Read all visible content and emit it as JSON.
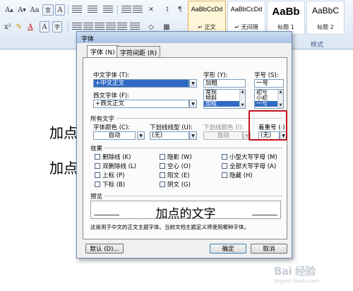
{
  "ribbon": {
    "font_buttons": [
      "A",
      "A",
      "Aa",
      "wén",
      "A"
    ],
    "style_gallery": [
      {
        "sample": "AaBbCcDd",
        "name": "↵ 正文",
        "selected": true
      },
      {
        "sample": "AaBbCcDd",
        "name": "↵ 无间隔",
        "selected": false
      },
      {
        "sample": "AaBb",
        "name": "标题 1",
        "selected": false
      },
      {
        "sample": "AaBbC",
        "name": "标题 2",
        "selected": false
      }
    ],
    "styles_group_label": "样式"
  },
  "document": {
    "line1": "加点",
    "line2": "加点"
  },
  "dialog": {
    "title": "字体",
    "tabs": [
      "字体 (N)",
      "字符间距 (R)"
    ],
    "chinese_font": {
      "label": "中文字体 (T):",
      "value": "+中文正文"
    },
    "western_font": {
      "label": "西文字体 (F):",
      "value": "+西文正文"
    },
    "font_style": {
      "label": "字形 (Y):",
      "value": "加粗",
      "options": [
        "常规",
        "倾斜",
        "加粗"
      ],
      "selected": "加粗"
    },
    "font_size": {
      "label": "字号 (S):",
      "value": "一号",
      "options": [
        "初号",
        "小初",
        "一号"
      ],
      "selected": "一号"
    },
    "all_text_label": "所有文字",
    "font_color": {
      "label": "字体颜色 (C):",
      "value": "自动"
    },
    "underline_style": {
      "label": "下划线线型 (U):",
      "value": "(无)"
    },
    "underline_color": {
      "label": "下划线颜色 (I):",
      "value": "自动"
    },
    "emphasis_mark": {
      "label": "着重号 (·)：",
      "value": "(无)"
    },
    "effects_label": "效果",
    "effects": [
      "删除线 (K)",
      "隐影 (W)",
      "小型大写字母 (M)",
      "双删除线 (L)",
      "空心 (O)",
      "全部大写字母 (A)",
      "上标 (P)",
      "阳文 (E)",
      "隐藏 (H)",
      "下标 (B)",
      "阴文 (G)"
    ],
    "preview_label": "预览",
    "preview_text": "加点的文字",
    "preview_note": "这是用于中文的正文主题字体。当前文档主题定义将使用哪种字体。",
    "buttons": {
      "default": "默认 (D)...",
      "ok": "确定",
      "cancel": "取消"
    }
  },
  "watermark": {
    "text": "Bai 经验",
    "sub": "jingyan.baidu.com"
  }
}
